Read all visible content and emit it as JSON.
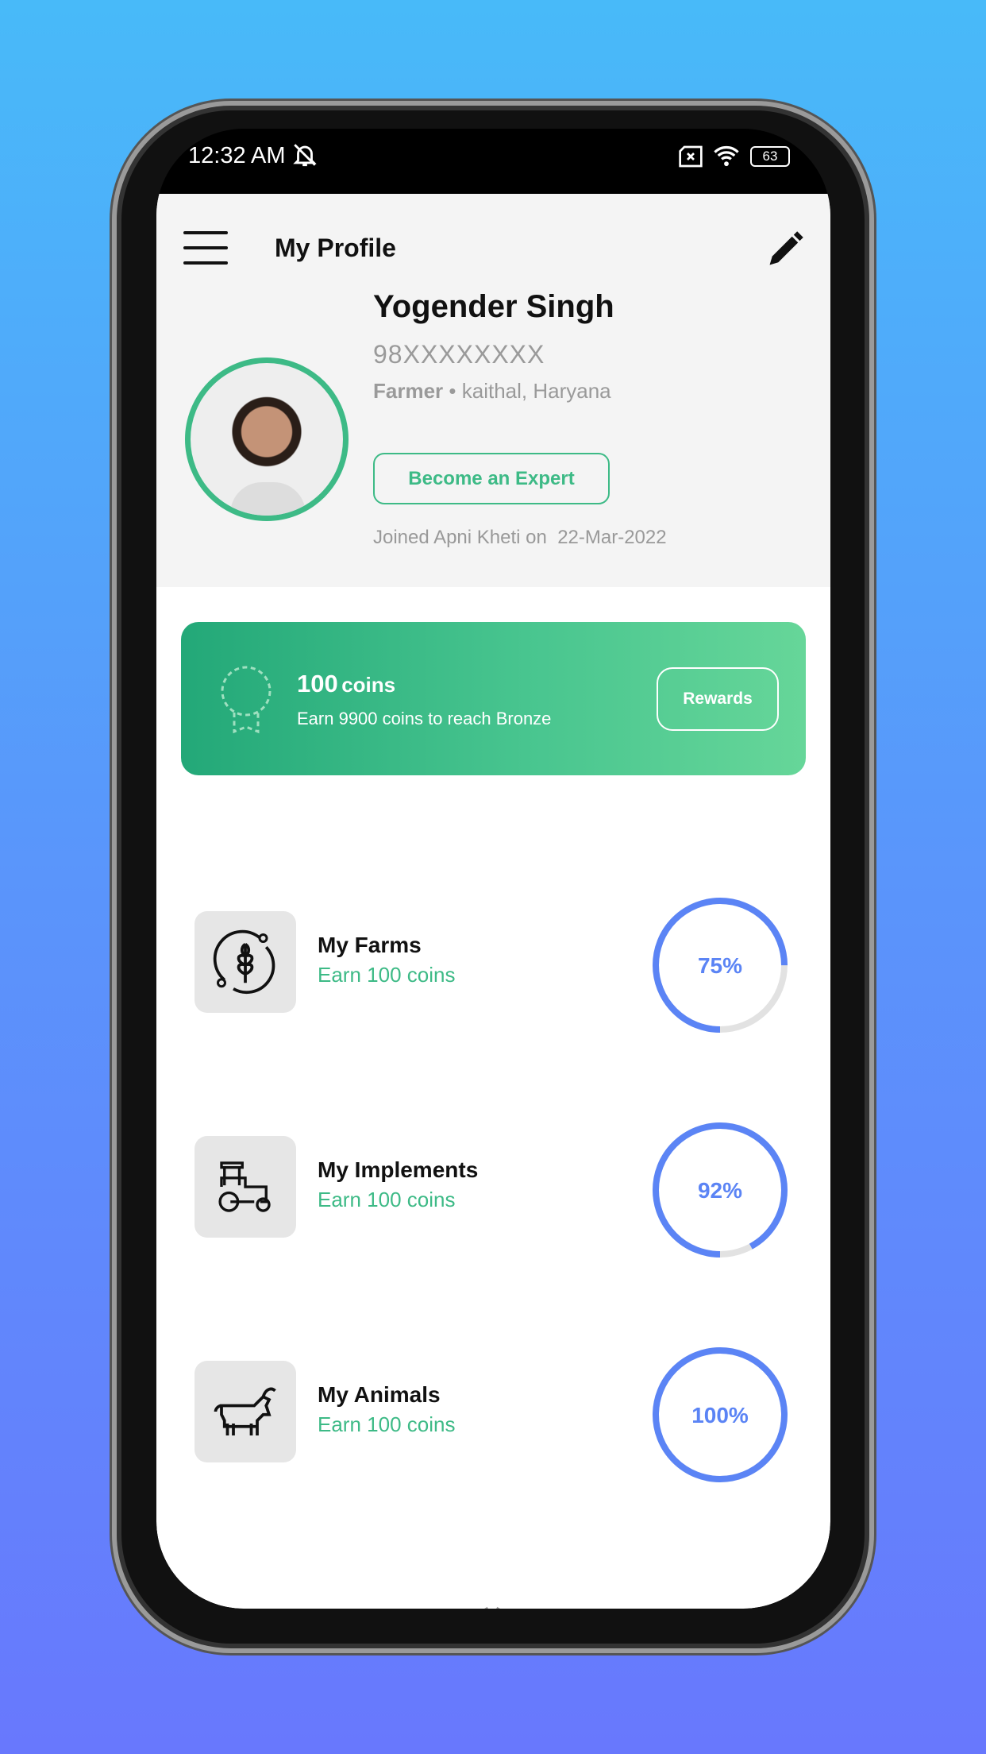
{
  "status_bar": {
    "time": "12:32 AM",
    "battery": "63",
    "icons": [
      "bell-off-icon",
      "sim-x-icon",
      "wifi-icon",
      "battery-icon"
    ]
  },
  "header": {
    "title": "My Profile",
    "menu_icon": "hamburger-icon",
    "edit_icon": "pencil-icon"
  },
  "profile": {
    "name": "Yogender Singh",
    "phone": "98XXXXXXXX",
    "role": "Farmer",
    "separator": "•",
    "location": "kaithal, Haryana",
    "expert_button": "Become an Expert",
    "joined_label": "Joined Apni Kheti on",
    "joined_date": "22-Mar-2022"
  },
  "coins": {
    "amount": "100",
    "unit": "coins",
    "subtitle": "Earn 9900 coins to reach Bronze",
    "button": "Rewards",
    "icon": "badge-icon"
  },
  "items": [
    {
      "title": "My Farms",
      "subtitle": "Earn 100 coins",
      "progress": 75,
      "progress_label": "75%",
      "icon": "wheat-icon"
    },
    {
      "title": "My Implements",
      "subtitle": "Earn 100 coins",
      "progress": 92,
      "progress_label": "92%",
      "icon": "tractor-icon"
    },
    {
      "title": "My Animals",
      "subtitle": "Earn 100 coins",
      "progress": 100,
      "progress_label": "100%",
      "icon": "goat-icon"
    }
  ],
  "nav": [
    {
      "icon": "home-icon"
    },
    {
      "icon": "qa-icon"
    },
    {
      "icon": "video-icon"
    },
    {
      "icon": "store-icon"
    },
    {
      "icon": "profile-icon",
      "active": true
    }
  ],
  "colors": {
    "accent": "#3dba86",
    "progress": "#5b84f5",
    "track": "#e2e2e2",
    "header_bg": "#f4f4f4"
  }
}
